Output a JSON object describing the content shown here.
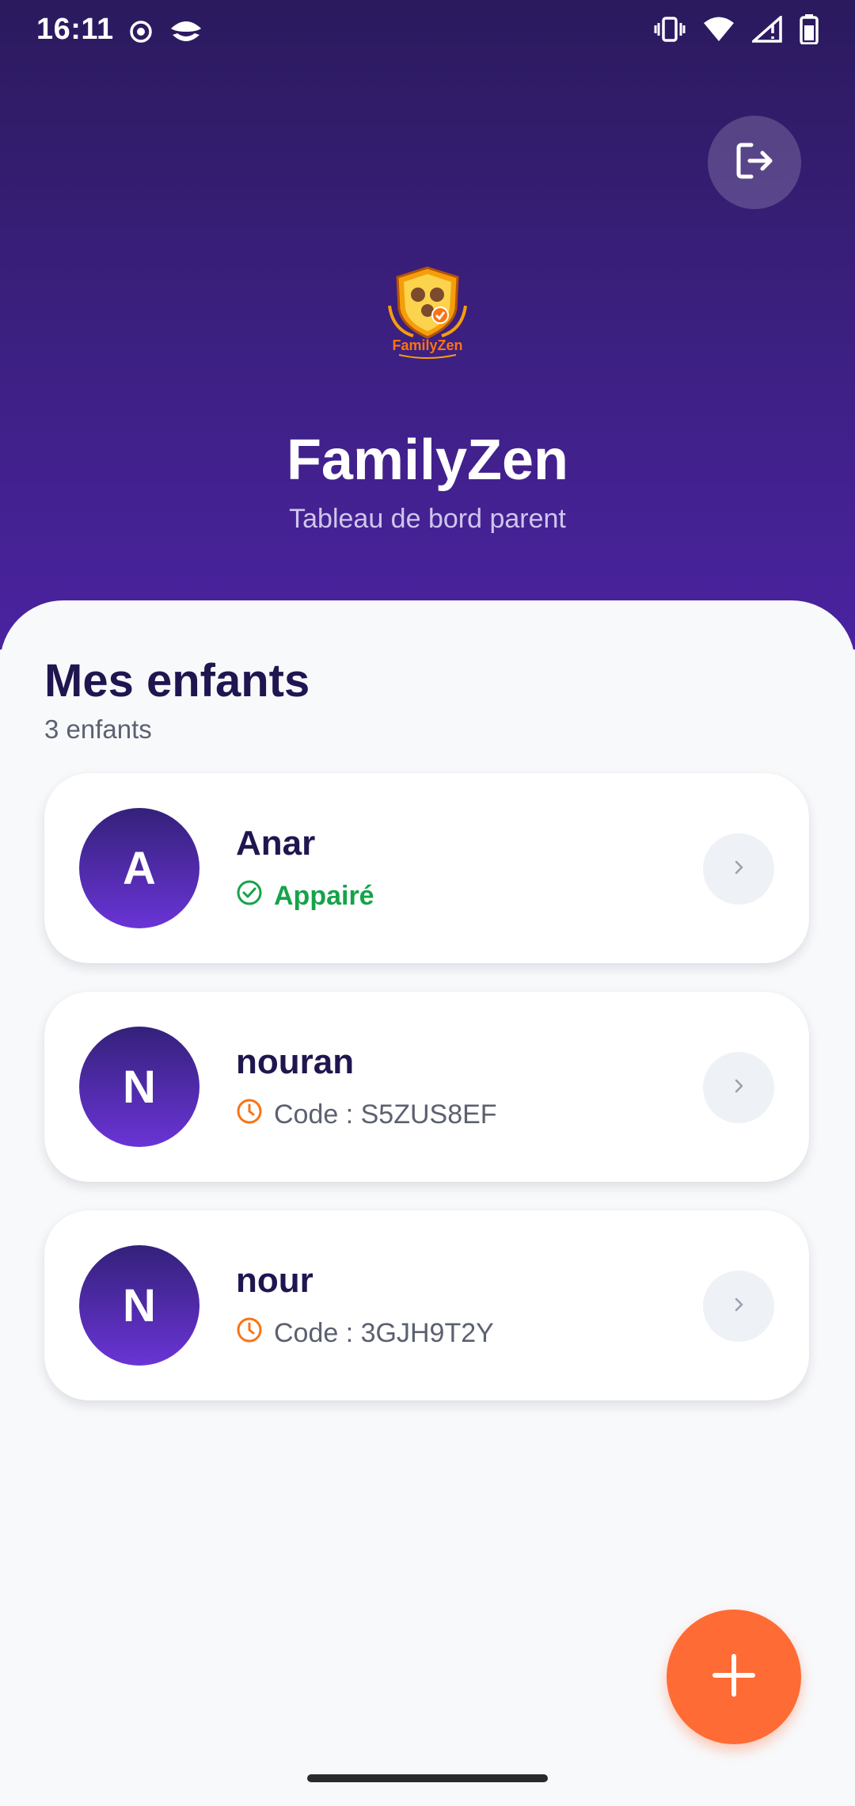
{
  "status_bar": {
    "time": "16:11",
    "icons": [
      "record-icon",
      "app-notification-icon",
      "vibrate-icon",
      "wifi-icon",
      "signal-icon",
      "battery-icon"
    ]
  },
  "header": {
    "logo_text": "FamilyZen",
    "title": "FamilyZen",
    "subtitle": "Tableau de bord parent",
    "logout_icon": "logout-icon",
    "colors": {
      "gradient_top": "#2b1a5e",
      "gradient_bottom": "#4a23a0"
    }
  },
  "section": {
    "title": "Mes enfants",
    "count": "3 enfants"
  },
  "children": [
    {
      "initial": "A",
      "name": "Anar",
      "status": "Appairé",
      "status_type": "paired",
      "status_icon": "check-circle-icon"
    },
    {
      "initial": "N",
      "name": "nouran",
      "status": "Code : S5ZUS8EF",
      "status_type": "pending",
      "status_icon": "clock-icon"
    },
    {
      "initial": "N",
      "name": "nour",
      "status": "Code : 3GJH9T2Y",
      "status_type": "pending",
      "status_icon": "clock-icon"
    }
  ],
  "fab": {
    "icon": "plus-icon",
    "color": "#ff6b35"
  },
  "colors": {
    "paired": "#16a34a",
    "pending": "#f97316",
    "primary_text": "#1f1650"
  }
}
